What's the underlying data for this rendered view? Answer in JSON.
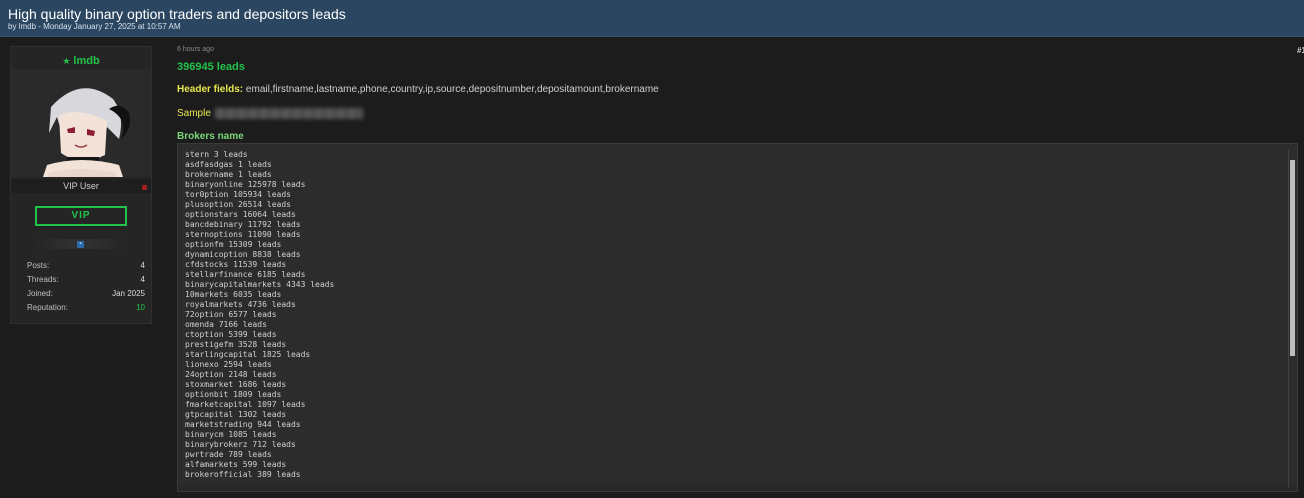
{
  "thread": {
    "title": "High quality binary option traders and depositors leads",
    "byline": "by lmdb - Monday January 27, 2025 at 10:57 AM"
  },
  "user": {
    "star": "★",
    "username": "lmdb",
    "role": "VIP User",
    "badge": "VIP",
    "stats": [
      {
        "label": "Posts:",
        "value": "4"
      },
      {
        "label": "Threads:",
        "value": "4"
      },
      {
        "label": "Joined:",
        "value": "Jan 2025"
      },
      {
        "label": "Reputation:",
        "value": "10"
      }
    ],
    "colors": {
      "accent": "#22c34a",
      "status": "#a02020"
    }
  },
  "post": {
    "time": "6 hours ago",
    "number": "#1",
    "leads_count": "396945 leads",
    "header_label": "Header fields:",
    "header_value": "email,firstname,lastname,phone,country,ip,source,depositnumber,depositamount,brokername",
    "sample_label": "Sample",
    "brokers_title": "Brokers name",
    "brokers": [
      "stern 3 leads",
      "asdfasdgas 1 leads",
      "brokername 1 leads",
      "binaryonline 125978 leads",
      "tor0ption 105934 leads",
      "plusoption 26514 leads",
      "optionstars 16064 leads",
      "bancdebinary 11792 leads",
      "sternoptions 11090 leads",
      "optionfm 15309 leads",
      "dynamicoption 8838 leads",
      "cfdstocks 11539 leads",
      "stellarfinance 6185 leads",
      "binarycapitalmarkets 4343 leads",
      "10markets 6035 leads",
      "royalmarkets 4736 leads",
      "72option 6577 leads",
      "omenda 7166 leads",
      "ctoption 5399 leads",
      "prestigefm 3528 leads",
      "starlingcapital 1825 leads",
      "lionexo 2594 leads",
      "24option 2148 leads",
      "stoxmarket 1686 leads",
      "optionbit 1809 leads",
      "fmarketcapital 1097 leads",
      "gtpcapital 1302 leads",
      "marketstrading 944 leads",
      "binarycm 1085 leads",
      "binarybrokerz 712 leads",
      "pwrtrade 789 leads",
      "alfamarkets 599 leads",
      "brokerofficial 389 leads"
    ]
  }
}
